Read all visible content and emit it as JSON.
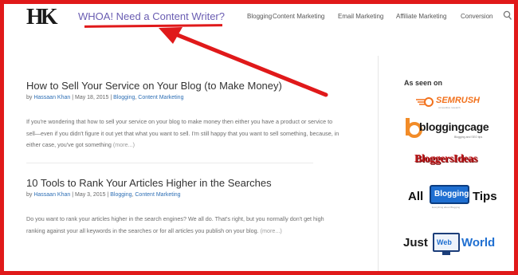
{
  "header": {
    "logo_text": "HK",
    "tagline": "WHOA! Need a Content Writer?",
    "nav": [
      "Blogging",
      "Content Marketing",
      "Email Marketing",
      "Affiliate Marketing",
      "Conversion"
    ],
    "search_icon": "search-icon"
  },
  "posts": [
    {
      "title": "How to Sell Your Service on Your Blog (to Make Money)",
      "meta_prefix": "by ",
      "author": "Hassaan Khan",
      "date": "May 18, 2015",
      "categories": [
        "Blogging",
        "Content Marketing"
      ],
      "excerpt": "If you're wondering that how to sell your service on your blog to make money then either you have a product or service to sell—even if you didn't figure it out yet that what you want to sell. I'm still happy that you want to sell something, because, in either case, you've got something",
      "more": "(more...)"
    },
    {
      "title": "10 Tools to Rank Your Articles Higher in the Searches",
      "meta_prefix": "by ",
      "author": "Hassaan Khan",
      "date": "May 3, 2015",
      "categories": [
        "Blogging",
        "Content Marketing"
      ],
      "excerpt": "Do you want to rank your articles higher in the search engines? We all do. That's right, but you normally don't get high ranking against your all keywords in the searches or for all articles you publish on your blog.",
      "more": "(more...)"
    }
  ],
  "sidebar": {
    "heading": "As seen on",
    "logos": [
      {
        "name": "SEMRUSH",
        "tagline": "competitive research"
      },
      {
        "name": "bloggingcage",
        "tagline": "Blogging and SEO tips"
      },
      {
        "name": "BloggersIdeas"
      },
      {
        "name": "All Blogging Tips",
        "word1": "All",
        "word2": "Blogging",
        "word3": "Tips",
        "tagline": "Everything about Blogging"
      },
      {
        "name": "JustWebWorld",
        "word1": "Just",
        "word2": "Web",
        "word3": "World"
      }
    ]
  },
  "colors": {
    "annotation_red": "#e0191a",
    "tagline_purple": "#6a5db2",
    "link_blue": "#2e6fb5",
    "semrush_orange": "#f2711c"
  }
}
